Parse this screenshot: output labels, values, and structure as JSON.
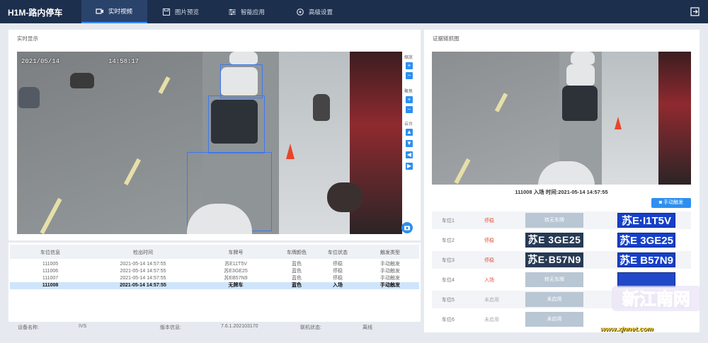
{
  "app": {
    "title": "H1M-路内停车",
    "nav": [
      {
        "label": "实时视频",
        "icon": "video-icon",
        "active": true
      },
      {
        "label": "图片预览",
        "icon": "image-icon",
        "active": false
      },
      {
        "label": "智能应用",
        "icon": "sliders-icon",
        "active": false
      },
      {
        "label": "高级设置",
        "icon": "gear-icon",
        "active": false
      }
    ]
  },
  "live": {
    "title": "实时显示",
    "osd_date": "2021/05/14",
    "osd_time": "14:58:17",
    "controls": {
      "zoom_label": "缩放",
      "focus_label": "聚焦",
      "ptz_label": "云台"
    }
  },
  "table": {
    "headers": [
      "车位信息",
      "检出时间",
      "车牌号",
      "车牌颜色",
      "车位状态",
      "触发类型"
    ],
    "rows": [
      [
        "111005",
        "2021-05-14 14:57:55",
        "苏E11T5V",
        "蓝色",
        "停稳",
        "手动触发"
      ],
      [
        "111006",
        "2021-05-14 14:57:55",
        "苏E3GE25",
        "蓝色",
        "停稳",
        "手动触发"
      ],
      [
        "111007",
        "2021-05-14 14:57:55",
        "苏EB57N9",
        "蓝色",
        "停稳",
        "手动触发"
      ],
      [
        "111008",
        "2021-05-14 14:57:55",
        "无牌车",
        "蓝色",
        "入场",
        "手动触发"
      ]
    ],
    "selected_row": 3
  },
  "footer": {
    "device_label": "设备名称:",
    "device_value": "IVS",
    "version_label": "版本信息:",
    "version_value": "7.6.1.202103170",
    "network_label": "联机状态:",
    "network_value": "离线"
  },
  "evidence": {
    "title": "证据链抓图",
    "caption": "111008 入场 时间:2021-05-14 14:57:55",
    "manual_button": "手动触发",
    "slots": [
      {
        "label": "车位1",
        "status": "停稳",
        "crop": "",
        "crop_text": "转无车牌",
        "plate": "苏E·I1T5V"
      },
      {
        "label": "车位2",
        "status": "停稳",
        "crop": "苏E 3GE25",
        "crop_text": "",
        "plate": "苏E 3GE25"
      },
      {
        "label": "车位3",
        "status": "停稳",
        "crop": "苏E·B57N9",
        "crop_text": "",
        "plate": "苏E B57N9"
      },
      {
        "label": "车位4",
        "status": "入场",
        "crop": "",
        "crop_text": "转无车牌",
        "plate": ""
      },
      {
        "label": "车位5",
        "status": "未启用",
        "crop": "",
        "crop_text": "未启用",
        "plate": ""
      },
      {
        "label": "车位6",
        "status": "未启用",
        "crop": "",
        "crop_text": "未启用",
        "plate": ""
      }
    ]
  },
  "watermark": {
    "text": "新江南网",
    "url": "www.xjnnet.com"
  },
  "colors": {
    "topbar": "#1c2f4d",
    "accent": "#2e8ff0",
    "plate_blue": "#1540c8",
    "status_red": "#e0533a"
  }
}
